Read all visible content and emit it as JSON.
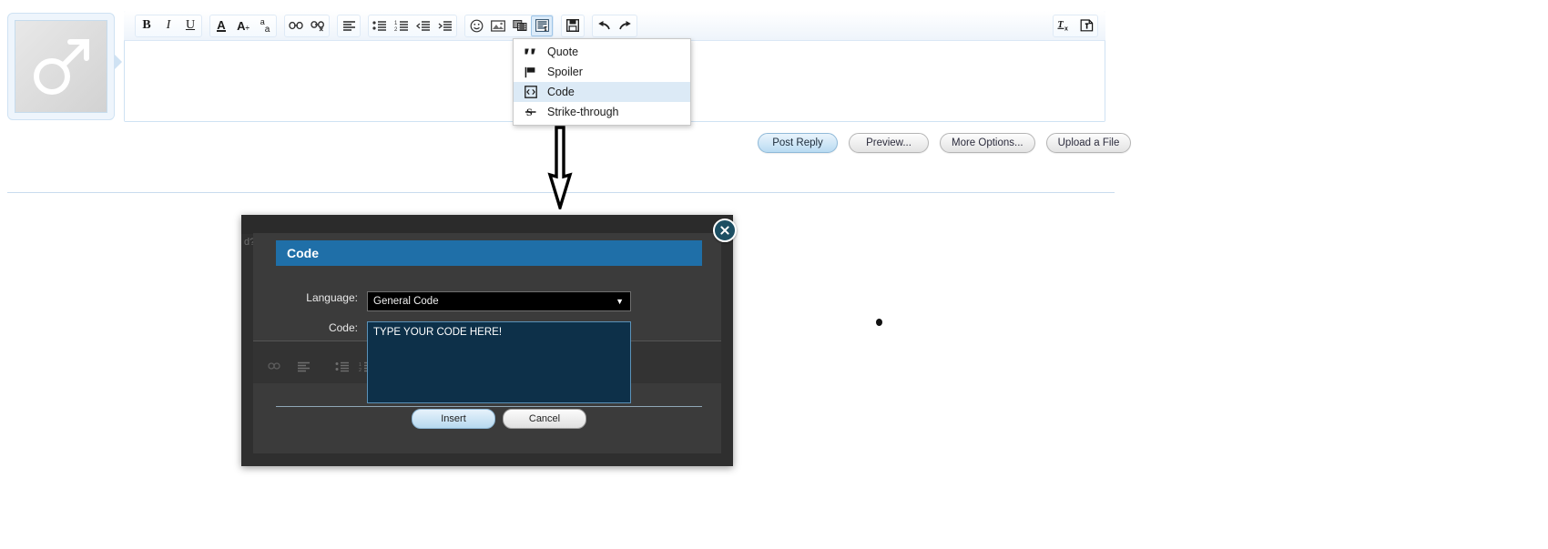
{
  "editor": {
    "avatar": {
      "icon": "mars-symbol-icon",
      "alt": "default user avatar"
    },
    "toolbar": {
      "groups": [
        {
          "name": "text-style",
          "buttons": [
            {
              "name": "bold-button",
              "icon": "bold-icon",
              "label": "B"
            },
            {
              "name": "italic-button",
              "icon": "italic-icon",
              "label": "I"
            },
            {
              "name": "underline-button",
              "icon": "underline-icon",
              "label": "U"
            }
          ]
        },
        {
          "name": "font-style",
          "buttons": [
            {
              "name": "font-color-button",
              "icon": "font-color-icon",
              "label": "A"
            },
            {
              "name": "font-size-button",
              "icon": "font-size-icon",
              "label": "A÷"
            },
            {
              "name": "font-face-button",
              "icon": "font-face-icon",
              "label": "aa"
            }
          ]
        },
        {
          "name": "link",
          "buttons": [
            {
              "name": "insert-link-button",
              "icon": "link-icon",
              "label": ""
            },
            {
              "name": "remove-link-button",
              "icon": "unlink-icon",
              "label": ""
            }
          ]
        },
        {
          "name": "align",
          "buttons": [
            {
              "name": "align-button",
              "icon": "align-left-icon",
              "label": ""
            }
          ]
        },
        {
          "name": "lists",
          "buttons": [
            {
              "name": "bullet-list-button",
              "icon": "bullet-list-icon",
              "label": ""
            },
            {
              "name": "numbered-list-button",
              "icon": "numbered-list-icon",
              "label": ""
            },
            {
              "name": "outdent-button",
              "icon": "outdent-icon",
              "label": ""
            },
            {
              "name": "indent-button",
              "icon": "indent-icon",
              "label": ""
            }
          ]
        },
        {
          "name": "insert",
          "buttons": [
            {
              "name": "emoji-button",
              "icon": "smiley-icon",
              "label": ""
            },
            {
              "name": "image-button",
              "icon": "image-icon",
              "label": ""
            },
            {
              "name": "media-button",
              "icon": "film-icon",
              "label": ""
            },
            {
              "name": "bbcode-button",
              "icon": "bbcode-paragraph-icon",
              "label": "",
              "active": true
            }
          ]
        },
        {
          "name": "save",
          "buttons": [
            {
              "name": "save-draft-button",
              "icon": "floppy-disk-icon",
              "label": ""
            }
          ]
        },
        {
          "name": "history",
          "buttons": [
            {
              "name": "undo-button",
              "icon": "undo-arrow-icon",
              "label": ""
            },
            {
              "name": "redo-button",
              "icon": "redo-arrow-icon",
              "label": ""
            }
          ]
        },
        {
          "name": "right-tools",
          "buttons": [
            {
              "name": "remove-formatting-button",
              "icon": "tx-remove-format-icon",
              "label": ""
            },
            {
              "name": "source-mode-button",
              "icon": "page-source-icon",
              "label": ""
            }
          ]
        }
      ]
    },
    "content": "",
    "actions": [
      {
        "name": "post-reply-button",
        "label": "Post Reply",
        "primary": true
      },
      {
        "name": "preview-button",
        "label": "Preview...",
        "primary": false
      },
      {
        "name": "more-options-button",
        "label": "More Options...",
        "primary": false
      },
      {
        "name": "upload-file-button",
        "label": "Upload a File",
        "primary": false
      }
    ]
  },
  "dropdown": {
    "name": "bbcode-dropdown-menu",
    "items": [
      {
        "label": "Quote",
        "icon": "quote-marks-icon",
        "highlighted": false
      },
      {
        "label": "Spoiler",
        "icon": "flag-icon",
        "highlighted": false
      },
      {
        "label": "Code",
        "icon": "code-brackets-icon",
        "highlighted": true
      },
      {
        "label": "Strike-through",
        "icon": "strikethrough-s-icon",
        "highlighted": false
      }
    ]
  },
  "annotation": {
    "arrow": {
      "name": "down-arrow-annotation",
      "direction": "down"
    },
    "dot": {
      "name": "cursor-dot-annotation"
    }
  },
  "modal": {
    "title": "Code",
    "ghost_text": "d?",
    "close_icon": "close-x-icon",
    "fields": [
      {
        "name": "language-field",
        "label": "Language:",
        "type": "select",
        "value": "General Code",
        "arrow_icon": "chevron-down-icon"
      },
      {
        "name": "code-field",
        "label": "Code:",
        "type": "textarea",
        "value": "TYPE YOUR CODE HERE!"
      }
    ],
    "buttons": [
      {
        "name": "insert-button",
        "label": "Insert",
        "primary": true
      },
      {
        "name": "cancel-button",
        "label": "Cancel",
        "primary": false
      }
    ]
  }
}
